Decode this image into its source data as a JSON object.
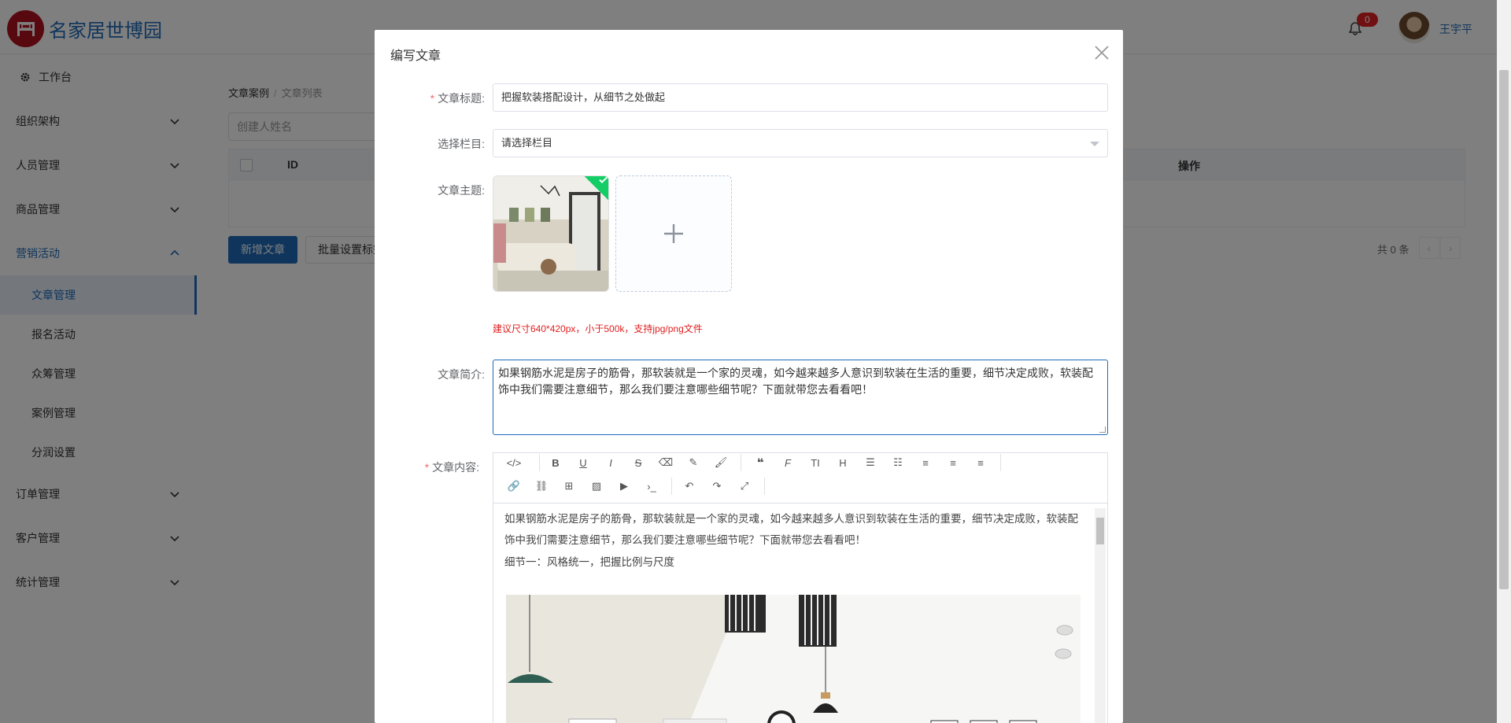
{
  "header": {
    "brand": "名家居世博园",
    "notification_count": "0",
    "user_name": "王宇平"
  },
  "sidebar": {
    "dashboard": "工作台",
    "groups": [
      "组织架构",
      "人员管理",
      "商品管理",
      "营销活动"
    ],
    "marketing_sub": [
      "文章管理",
      "报名活动",
      "众筹管理",
      "案例管理",
      "分润设置"
    ],
    "lower_groups": [
      "订单管理",
      "客户管理",
      "统计管理"
    ]
  },
  "main": {
    "breadcrumb": [
      "文章案例",
      "文章列表"
    ],
    "filter_placeholder": "创建人姓名",
    "table": {
      "col_id": "ID",
      "col_op": "操作"
    },
    "add_button": "新增文章",
    "batch_button": "批量设置标签",
    "total": "共 0 条"
  },
  "dialog": {
    "title": "编写文章",
    "title_label": "文章标题:",
    "title_value": "把握软装搭配设计，从细节之处做起",
    "column_label": "选择栏目:",
    "column_value": "请选择栏目",
    "cover_label": "文章主题:",
    "upload_hint": "建议尺寸640*420px，小于500k，支持jpg/png文件",
    "summary_label": "文章简介:",
    "summary_value": "如果钢筋水泥是房子的筋骨，那软装就是一个家的灵魂，如今越来越多人意识到软装在生活的重要，细节决定成败，软装配饰中我们需要注意细节，那么我们要注意哪些细节呢？下面就带您去看看吧！",
    "content_label": "文章内容:",
    "content_paragraph_1": "如果钢筋水泥是房子的筋骨，那软装就是一个家的灵魂，如今越来越多人意识到软装在生活的重要，细节决定成败，软装配饰中我们需要注意细节，那么我们要注意哪些细节呢？下面就带您去看看吧！",
    "content_paragraph_2": "细节一：风格统一，把握比例与尺度"
  },
  "colors": {
    "brand_blue": "#1e6bb8",
    "logo_red": "#b1121f",
    "required_red": "#f56c6c",
    "success_green": "#13ce66"
  }
}
